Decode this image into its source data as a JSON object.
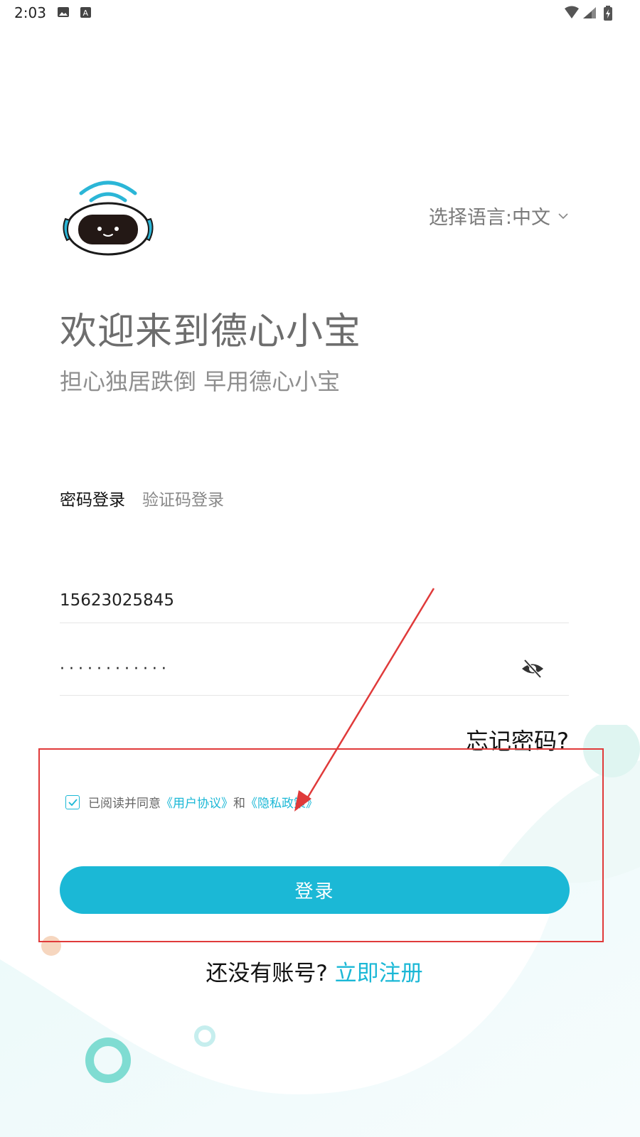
{
  "status_bar": {
    "time": "2:03",
    "icons": [
      "image-icon",
      "a-icon",
      "wifi-icon",
      "signal-icon",
      "battery-icon"
    ]
  },
  "header": {
    "language_label": "选择语言:",
    "language_value": "中文"
  },
  "welcome": {
    "title": "欢迎来到德心小宝",
    "slogan": "担心独居跌倒 早用德心小宝"
  },
  "tabs": [
    {
      "label": "密码登录",
      "active": true
    },
    {
      "label": "验证码登录",
      "active": false
    }
  ],
  "form": {
    "phone_value": "15623025845",
    "password_value": "············",
    "forgot_label": "忘记密码?"
  },
  "agreement": {
    "checked": true,
    "prefix": "已阅读并同意",
    "user_agreement": "《用户协议》",
    "and": "和",
    "privacy_policy": "《隐私政策》"
  },
  "login_button": "登录",
  "register": {
    "prompt": "还没有账号?",
    "link": "立即注册"
  },
  "colors": {
    "accent": "#1bb8d6",
    "annotation": "#e03a3a"
  }
}
